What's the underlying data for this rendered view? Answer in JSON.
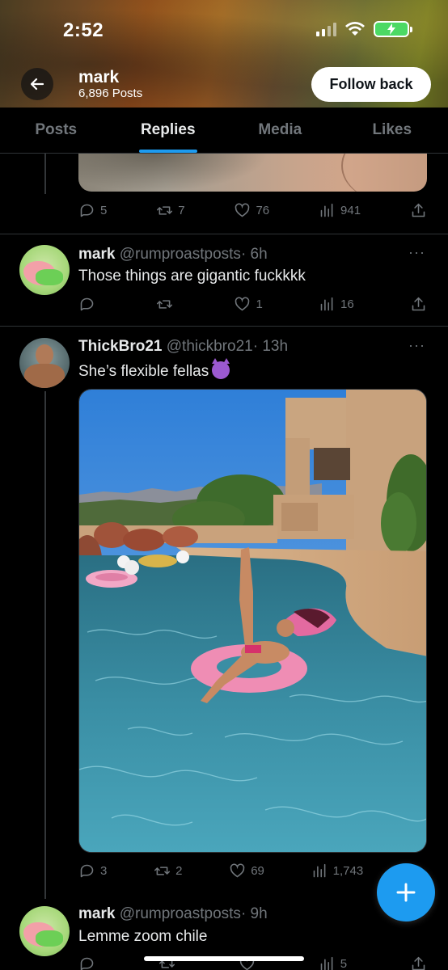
{
  "status_bar": {
    "time": "2:52"
  },
  "header": {
    "name": "mark",
    "post_count": "6,896 Posts",
    "follow_button": "Follow back"
  },
  "tabs": [
    {
      "label": "Posts",
      "active": false
    },
    {
      "label": "Replies",
      "active": true
    },
    {
      "label": "Media",
      "active": false
    },
    {
      "label": "Likes",
      "active": false
    }
  ],
  "posts": [
    {
      "id": "top-partial",
      "stats": {
        "replies": "5",
        "reposts": "7",
        "likes": "76",
        "views": "941"
      }
    },
    {
      "id": "mark-reply-1",
      "name": "mark",
      "handle": "@rumproastposts",
      "time": "· 6h",
      "text": "Those things are gigantic fuckkkk",
      "stats": {
        "replies": "",
        "reposts": "",
        "likes": "1",
        "views": "16"
      }
    },
    {
      "id": "thickbro-post",
      "name": "ThickBro21",
      "handle": "@thickbro21",
      "time": "· 13h",
      "text": "She’s flexible fellas",
      "emoji": "smiling-imp",
      "stats": {
        "replies": "3",
        "reposts": "2",
        "likes": "69",
        "views": "1,743"
      }
    },
    {
      "id": "mark-reply-2",
      "name": "mark",
      "handle": "@rumproastposts",
      "time": "· 9h",
      "text": "Lemme zoom chile",
      "stats": {
        "replies": "",
        "reposts": "",
        "likes": "",
        "views": "5"
      }
    }
  ],
  "colors": {
    "accent": "#1d9bf0",
    "muted": "#71767b",
    "divider": "#2f3336"
  },
  "more_glyph": "···"
}
